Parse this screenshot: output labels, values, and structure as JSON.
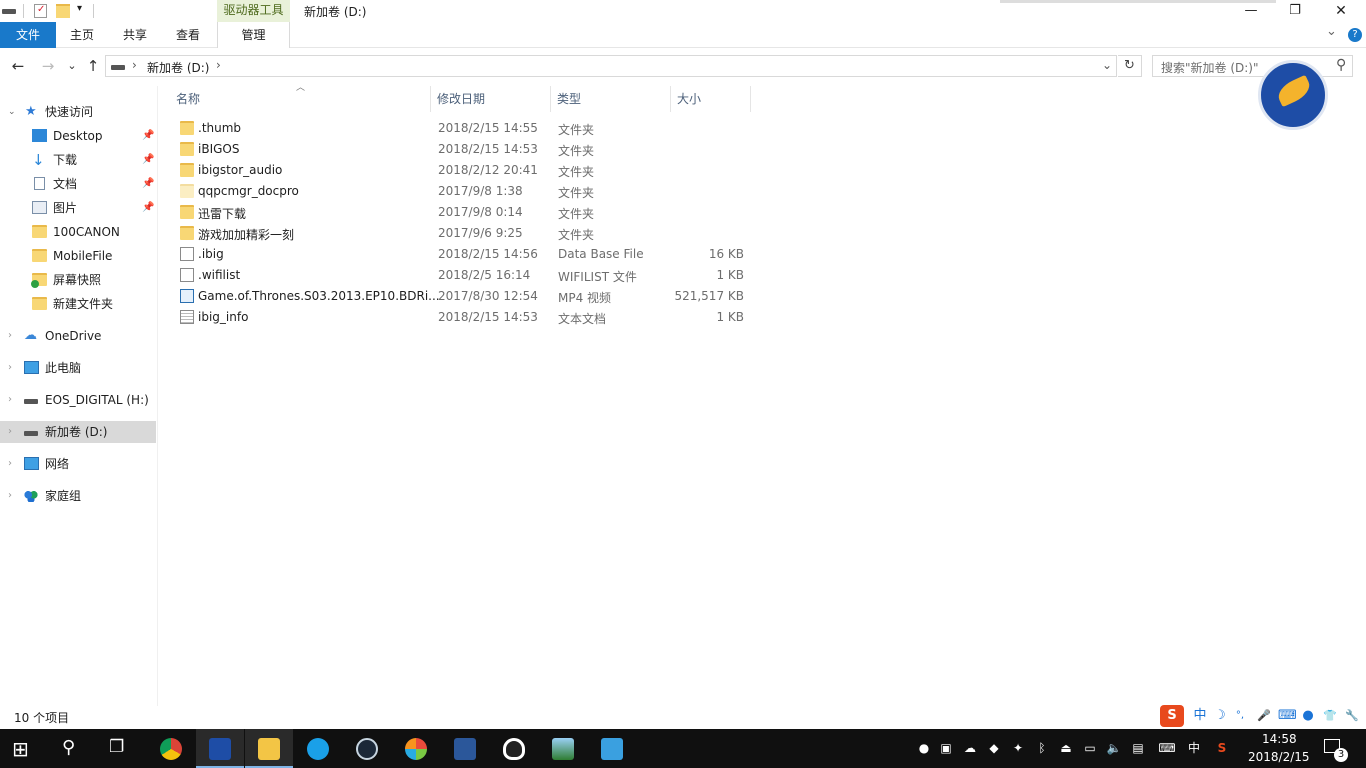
{
  "titlebar": {
    "context_tab": "驱动器工具",
    "title": "新加卷 (D:)",
    "minimize": "—",
    "restore": "❐",
    "close": "✕"
  },
  "ribbon": {
    "tabs": [
      "文件",
      "主页",
      "共享",
      "查看",
      "管理"
    ],
    "expand": "⌄",
    "help": "?"
  },
  "address": {
    "back": "←",
    "forward": "→",
    "recent": "⌄",
    "up": "↑",
    "path": "新加卷 (D:)",
    "sep": "›",
    "dropdown": "⌄",
    "refresh": "↻",
    "search_placeholder": "搜索\"新加卷 (D:)\"",
    "search_icon": "⚲"
  },
  "navpane": {
    "quick_access": "快速访问",
    "items": [
      {
        "label": "Desktop",
        "pinned": true
      },
      {
        "label": "下载",
        "pinned": true
      },
      {
        "label": "文档",
        "pinned": true
      },
      {
        "label": "图片",
        "pinned": true
      },
      {
        "label": "100CANON",
        "pinned": false
      },
      {
        "label": "MobileFile",
        "pinned": false
      },
      {
        "label": "屏幕快照",
        "pinned": false
      },
      {
        "label": "新建文件夹",
        "pinned": false
      }
    ],
    "onedrive": "OneDrive",
    "thispc": "此电脑",
    "eos": "EOS_DIGITAL (H:)",
    "newvol": "新加卷 (D:)",
    "network": "网络",
    "homegroup": "家庭组",
    "pin_glyph": "📌"
  },
  "columns": {
    "name": "名称",
    "modified": "修改日期",
    "type": "类型",
    "size": "大小"
  },
  "files": [
    {
      "name": ".thumb",
      "modified": "2018/2/15 14:55",
      "type": "文件夹",
      "size": "",
      "icon": "folder"
    },
    {
      "name": "iBIGOS",
      "modified": "2018/2/15 14:53",
      "type": "文件夹",
      "size": "",
      "icon": "folder"
    },
    {
      "name": "ibigstor_audio",
      "modified": "2018/2/12 20:41",
      "type": "文件夹",
      "size": "",
      "icon": "folder"
    },
    {
      "name": "qqpcmgr_docpro",
      "modified": "2017/9/8 1:38",
      "type": "文件夹",
      "size": "",
      "icon": "folder-light"
    },
    {
      "name": "迅雷下载",
      "modified": "2017/9/8 0:14",
      "type": "文件夹",
      "size": "",
      "icon": "folder"
    },
    {
      "name": "游戏加加精彩一刻",
      "modified": "2017/9/6 9:25",
      "type": "文件夹",
      "size": "",
      "icon": "folder"
    },
    {
      "name": ".ibig",
      "modified": "2018/2/15 14:56",
      "type": "Data Base File",
      "size": "16 KB",
      "icon": "file"
    },
    {
      "name": ".wifilist",
      "modified": "2018/2/5 16:14",
      "type": "WIFILIST 文件",
      "size": "1 KB",
      "icon": "file"
    },
    {
      "name": "Game.of.Thrones.S03.2013.EP10.BDRi...",
      "modified": "2017/8/30 12:54",
      "type": "MP4 视频",
      "size": "521,517 KB",
      "icon": "video"
    },
    {
      "name": "ibig_info",
      "modified": "2018/2/15 14:53",
      "type": "文本文档",
      "size": "1 KB",
      "icon": "text"
    }
  ],
  "status": "10 个项目",
  "ime": {
    "brand": "S",
    "lang": "中",
    "moon": "☽",
    "punct": "°,",
    "mic": "🎤",
    "keyboard": "⌨",
    "skin": "👕",
    "tools": "🔧"
  },
  "taskbar": {
    "start": "⊞",
    "search": "⚲",
    "taskview": "❐",
    "apps": [
      "chrome",
      "bird-app",
      "file-explorer",
      "video-app",
      "steam",
      "game-app",
      "word",
      "qq",
      "photo-viewer",
      "remote-app"
    ],
    "tray_lang": "中",
    "time": "14:58",
    "date": "2018/2/15",
    "notif_count": "3"
  }
}
